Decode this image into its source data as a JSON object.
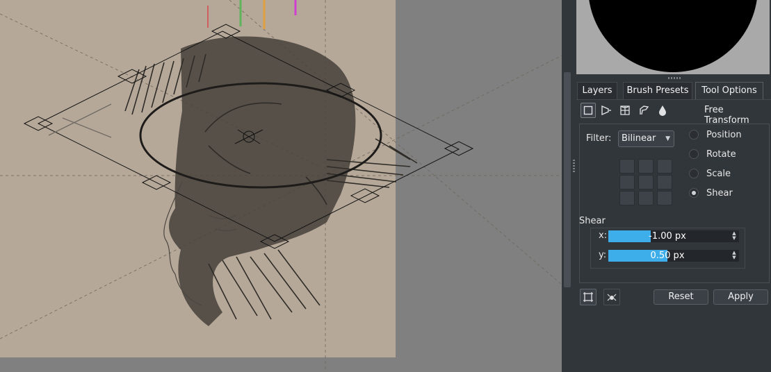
{
  "panel": {
    "tabs": [
      {
        "label": "Layers",
        "active": false
      },
      {
        "label": "Brush Presets",
        "active": false
      },
      {
        "label": "Tool Options",
        "active": true
      }
    ],
    "tool_modes": [
      {
        "icon": "free-transform-icon",
        "active": true
      },
      {
        "icon": "perspective-transform-icon",
        "active": false
      },
      {
        "icon": "warp-transform-icon",
        "active": false
      },
      {
        "icon": "cage-transform-icon",
        "active": false
      },
      {
        "icon": "liquify-transform-icon",
        "active": false
      }
    ],
    "mode_title": "Free Transform",
    "filter_label": "Filter:",
    "filter_value": "Bilinear",
    "radios": [
      {
        "label": "Position",
        "checked": false
      },
      {
        "label": "Rotate",
        "checked": false
      },
      {
        "label": "Scale",
        "checked": false
      },
      {
        "label": "Shear",
        "checked": true
      }
    ],
    "shear_title": "Shear",
    "shear_x": {
      "label": "x:",
      "display": "-1.00 px",
      "value": -1.0,
      "fill": 0.36
    },
    "shear_y": {
      "label": "y:",
      "display": "0.50 px",
      "value": 0.5,
      "fill": 0.5
    },
    "reset_label": "Reset",
    "apply_label": "Apply"
  },
  "colors": {
    "canvas_bg": "#808080",
    "paper": "#b6a898",
    "panel_bg": "#31363b",
    "accent": "#3daee9"
  }
}
